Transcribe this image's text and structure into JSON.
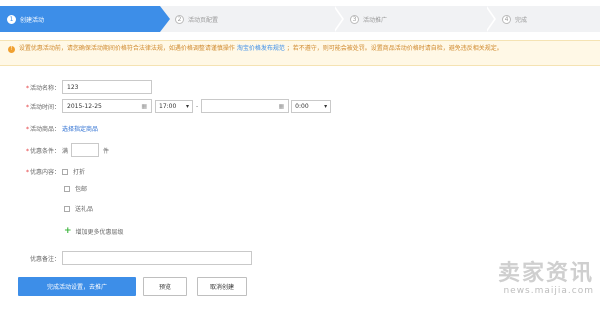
{
  "steps": [
    {
      "num": "1",
      "label": "创建活动"
    },
    {
      "num": "2",
      "label": "活动页配置"
    },
    {
      "num": "3",
      "label": "活动推广"
    },
    {
      "num": "4",
      "label": "完成"
    }
  ],
  "notice": {
    "text1": "设置优惠活动前，请您确保活动期间价格符合法律法规，如遇价格调整请谨慎操作",
    "link": "淘宝价格发布规范",
    "text2": "；若不遵守，则可能会被处罚。设置商品活动价格时请自检，避免违反相关规定。"
  },
  "form": {
    "name_label": "活动名称：",
    "name_value": "123",
    "time_label": "活动时间：",
    "start_date": "2015-12-25",
    "start_time": "17:00",
    "dash": "-",
    "end_date": "",
    "end_time": "0:00",
    "goods_label": "活动商品：",
    "goods_link": "选择指定商品",
    "condition_label": "优惠条件：",
    "condition_prefix": "满",
    "condition_value": "",
    "condition_unit": "件",
    "content_label": "优惠内容：",
    "options": [
      "打折",
      "包邮",
      "送礼品"
    ],
    "add_more": "增加更多优惠层级",
    "remark_label": "优惠备注：",
    "remark_value": ""
  },
  "buttons": {
    "primary": "完成活动设置，去推广",
    "preview": "预览",
    "cancel": "取消创建"
  },
  "watermark": {
    "big": "卖家资讯",
    "small": "news.maijia.com"
  }
}
